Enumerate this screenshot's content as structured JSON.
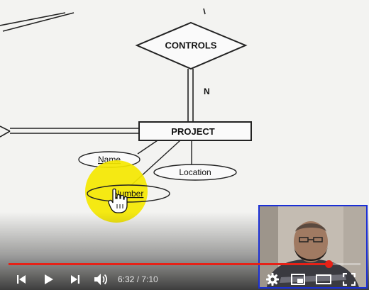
{
  "diagram": {
    "entity": "PROJECT",
    "relationship": "CONTROLS",
    "cardinality": "N",
    "attributes": [
      "Name",
      "Number",
      "Location"
    ]
  },
  "player": {
    "current_time": "6:32",
    "separator": " / ",
    "duration": "7:10",
    "progress_fraction": 0.91,
    "colors": {
      "progress": "#e62117",
      "highlight": "#f5e800",
      "webcam_border": "#1a2fd6"
    },
    "controls": {
      "previous": "skip-previous-icon",
      "play": "play-icon",
      "next": "skip-next-icon",
      "volume": "volume-icon",
      "settings": "gear-icon",
      "miniplayer": "miniplayer-icon",
      "theater": "theater-mode-icon",
      "fullscreen": "fullscreen-icon"
    }
  }
}
